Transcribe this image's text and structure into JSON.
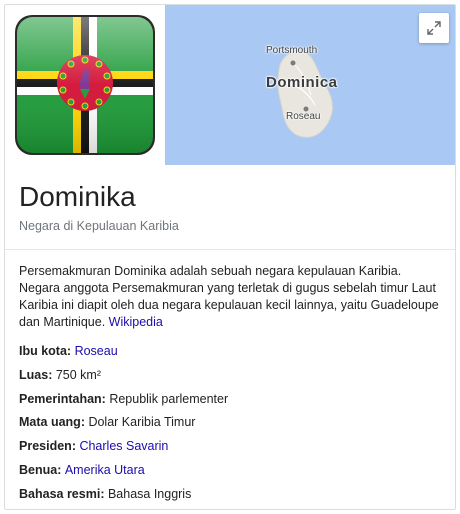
{
  "map": {
    "label_portsmouth": "Portsmouth",
    "label_country": "Dominica",
    "label_roseau": "Roseau",
    "expand_icon": "expand-icon"
  },
  "flag": {
    "icon": "dominica-flag-icon",
    "colors": {
      "green": "#1c9a36",
      "yellow": "#ffd400",
      "black": "#111111",
      "white": "#ffffff",
      "red": "#d21034"
    }
  },
  "header": {
    "title": "Dominika",
    "subtitle": "Negara di Kepulauan Karibia"
  },
  "description": {
    "text": "Persemakmuran Dominika adalah sebuah negara kepulauan Karibia. Negara anggota Persemakmuran yang terletak di gugus sebelah timur Laut Karibia ini diapit oleh dua negara kepulauan kecil lainnya, yaitu Guadeloupe dan Martinique. ",
    "source_link": "Wikipedia"
  },
  "facts": [
    {
      "key": "Ibu kota",
      "sep": ": ",
      "value": "Roseau",
      "link": true
    },
    {
      "key": "Luas",
      "sep": ": ",
      "value": "750 km²",
      "link": false
    },
    {
      "key": "Pemerintahan",
      "sep": ": ",
      "value": "Republik parlementer",
      "link": false
    },
    {
      "key": "Mata uang",
      "sep": ": ",
      "value": "Dolar Karibia Timur",
      "link": false
    },
    {
      "key": "Presiden",
      "sep": ": ",
      "value": "Charles Savarin",
      "link": true
    },
    {
      "key": "Benua",
      "sep": ": ",
      "value": "Amerika Utara",
      "link": true
    },
    {
      "key": "Bahasa resmi",
      "sep": ": ",
      "value": "Bahasa Inggris",
      "link": false
    }
  ],
  "colors": {
    "link": "#1a0dab",
    "map_water": "#a9c8f3",
    "map_land": "#e8e6df"
  }
}
